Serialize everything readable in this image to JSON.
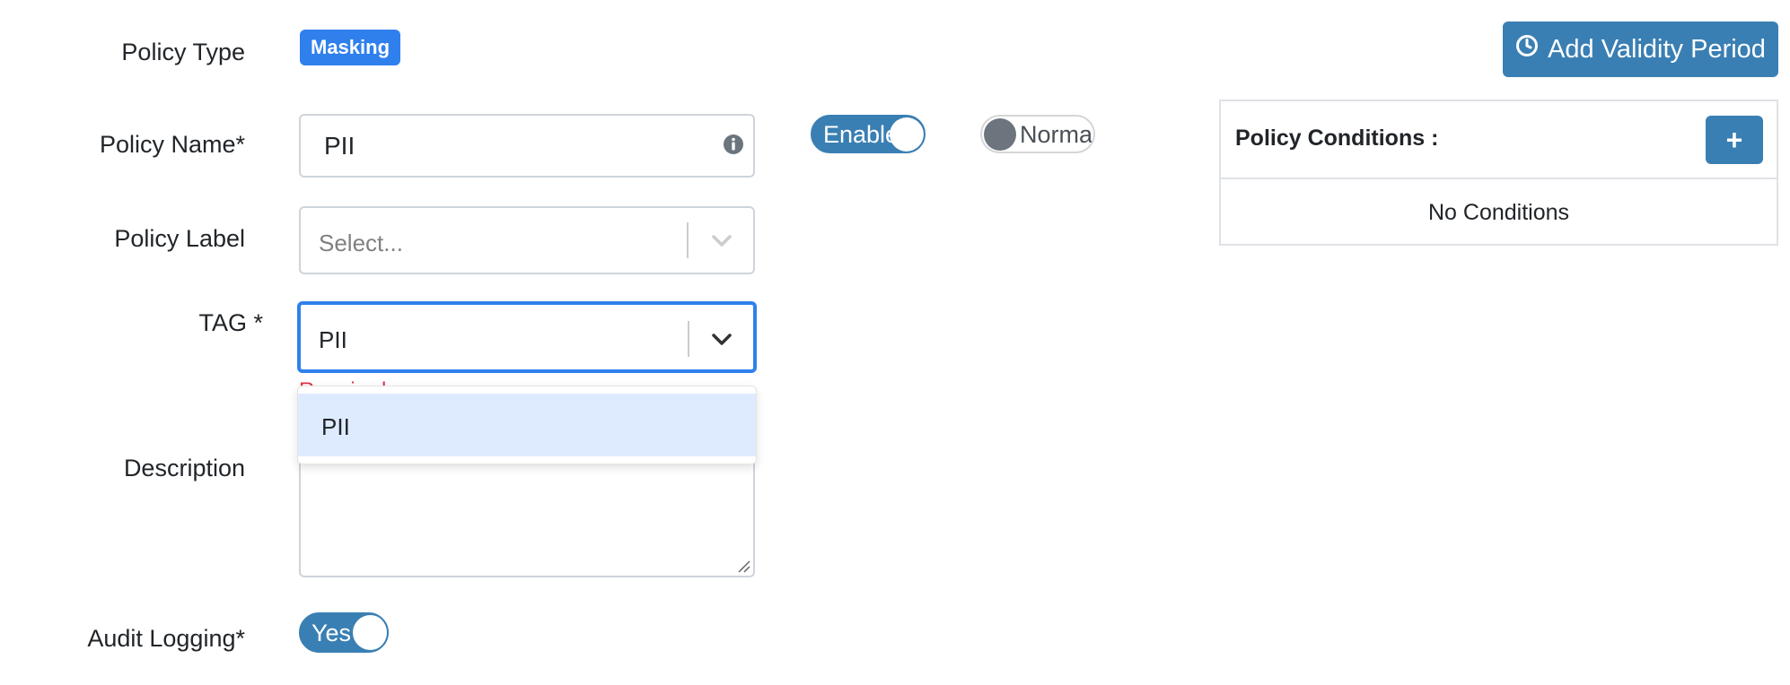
{
  "form": {
    "policy_type_label": "Policy Type",
    "policy_type_badge": "Masking",
    "policy_name_label": "Policy Name*",
    "policy_name_value": "PII",
    "policy_label_label": "Policy Label",
    "policy_label_placeholder": "Select...",
    "tag_label": "TAG *",
    "tag_value": "PII",
    "tag_error": "Required",
    "tag_menu_options": [
      "PII"
    ],
    "description_label": "Description",
    "description_value": "",
    "audit_logging_label": "Audit Logging*",
    "audit_logging_toggle": "Yes"
  },
  "toggles": {
    "enable_label": "Enabled",
    "normal_label": "Normal"
  },
  "actions": {
    "add_validity_period": "Add Validity Period"
  },
  "conditions": {
    "title": "Policy Conditions :",
    "add_button": "+",
    "empty_text": "No Conditions"
  },
  "icons": {
    "policy_name_info": "info-circle-icon",
    "select_chevron": "chevron-down-icon",
    "validity_clock": "clock-icon"
  },
  "colors": {
    "primary": "#3a7fb3",
    "badge": "#2f80ed",
    "focus_border": "#2f80ed",
    "menu_highlight": "#deebff",
    "error": "#dc3545"
  }
}
